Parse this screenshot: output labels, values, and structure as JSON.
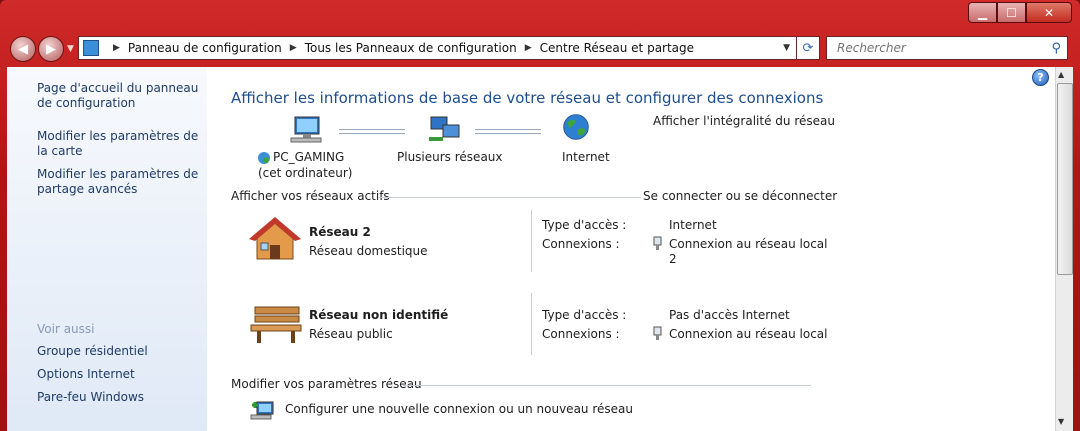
{
  "address": {
    "crumbs": [
      "Panneau de configuration",
      "Tous les Panneaux de configuration",
      "Centre Réseau et partage"
    ]
  },
  "search": {
    "placeholder": "Rechercher"
  },
  "sidebar": {
    "links": [
      "Page d'accueil du panneau de configuration",
      "Modifier les paramètres de la carte",
      "Modifier les paramètres de partage avancés"
    ],
    "see_also_label": "Voir aussi",
    "see_also": [
      "Groupe résidentiel",
      "Options Internet",
      "Pare-feu Windows"
    ]
  },
  "main": {
    "title": "Afficher les informations de base de votre réseau et configurer des connexions",
    "map": {
      "pc_name": "PC_GAMING",
      "pc_sub": "(cet ordinateur)",
      "multiple": "Plusieurs réseaux",
      "internet": "Internet",
      "full_map_link": "Afficher l'intégralité du réseau"
    },
    "active_header": "Afficher vos réseaux actifs",
    "connect_link": "Se connecter ou se déconnecter",
    "networks": [
      {
        "name": "Réseau  2",
        "type": "Réseau domestique",
        "access_label": "Type d'accès :",
        "access_value": "Internet",
        "conn_label": "Connexions :",
        "conn_value_line1": "Connexion au réseau local",
        "conn_value_line2": "2"
      },
      {
        "name": "Réseau non identifié",
        "type": "Réseau public",
        "access_label": "Type d'accès :",
        "access_value": "Pas d'accès Internet",
        "conn_label": "Connexions :",
        "conn_value_line1": "Connexion au réseau local"
      }
    ],
    "modify_header": "Modifier vos paramètres réseau",
    "setup_link": "Configurer une nouvelle connexion ou un nouveau réseau"
  }
}
